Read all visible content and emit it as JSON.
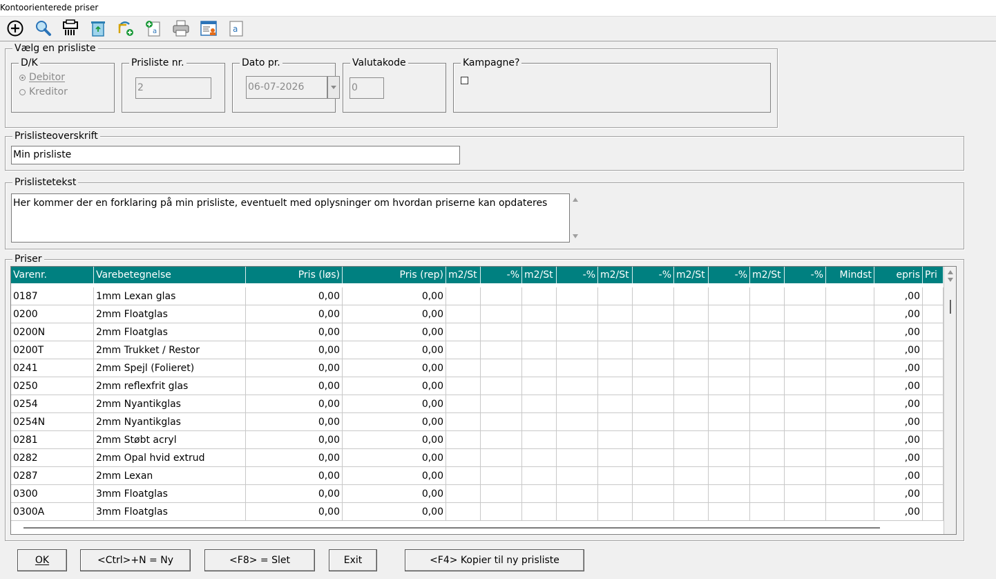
{
  "window": {
    "title": "Kontoorienterede priser"
  },
  "toolbar": {
    "icons": [
      "add-icon",
      "search-icon",
      "printer-list-icon",
      "recycle-bin-icon",
      "sync-add-icon",
      "new-document-icon",
      "printer-icon",
      "report-user-icon",
      "text-document-icon"
    ]
  },
  "pricelist_select": {
    "legend": "Vælg en prisliste",
    "dk": {
      "label": "D/K",
      "debitor": "Debitor",
      "kreditor": "Kreditor"
    },
    "nr": {
      "label": "Prisliste nr.",
      "value": "2"
    },
    "date": {
      "label": "Dato pr.",
      "value": "06-07-2026"
    },
    "currency": {
      "label": "Valutakode",
      "value": "0"
    },
    "campaign": {
      "label": "Kampagne?"
    }
  },
  "header_group": {
    "legend": "Prislisteoverskrift",
    "value": "Min prisliste"
  },
  "text_group": {
    "legend": "Prislistetekst",
    "value": "Her kommer der en forklaring på min prisliste, eventuelt med oplysninger om hvordan priserne kan opdateres"
  },
  "prices": {
    "legend": "Priser",
    "columns": [
      "Varenr.",
      "Varebetegnelse",
      "Pris (løs)",
      "Pris (rep)",
      "m2/St",
      "-%",
      "m2/St",
      "-%",
      "m2/St",
      "-%",
      "m2/St",
      "-%",
      "m2/St",
      "-%",
      "Mindst",
      "epris",
      "Pri"
    ],
    "rows": [
      [
        "0187",
        "1mm Lexan glas",
        "0,00",
        "0,00",
        ",00"
      ],
      [
        "0200",
        "2mm Floatglas",
        "0,00",
        "0,00",
        ",00"
      ],
      [
        "0200N",
        "2mm Floatglas",
        "0,00",
        "0,00",
        ",00"
      ],
      [
        "0200T",
        "2mm Trukket / Restor",
        "0,00",
        "0,00",
        ",00"
      ],
      [
        "0241",
        "2mm Spejl (Folieret)",
        "0,00",
        "0,00",
        ",00"
      ],
      [
        "0250",
        "2mm reflexfrit glas",
        "0,00",
        "0,00",
        ",00"
      ],
      [
        "0254",
        "2mm Nyantikglas",
        "0,00",
        "0,00",
        ",00"
      ],
      [
        "0254N",
        "2mm Nyantikglas",
        "0,00",
        "0,00",
        ",00"
      ],
      [
        "0281",
        "2mm Støbt acryl",
        "0,00",
        "0,00",
        ",00"
      ],
      [
        "0282",
        "2mm Opal hvid extrud",
        "0,00",
        "0,00",
        ",00"
      ],
      [
        "0287",
        "2mm Lexan",
        "0,00",
        "0,00",
        ",00"
      ],
      [
        "0300",
        "3mm Floatglas",
        "0,00",
        "0,00",
        ",00"
      ],
      [
        "0300A",
        "3mm Floatglas",
        "0,00",
        "0,00",
        ",00"
      ]
    ]
  },
  "buttons": {
    "ok": "OK",
    "new": "<Ctrl>+N = Ny",
    "delete": "<F8> = Slet",
    "exit": "Exit",
    "copy": "<F4> Kopier til ny prisliste"
  }
}
